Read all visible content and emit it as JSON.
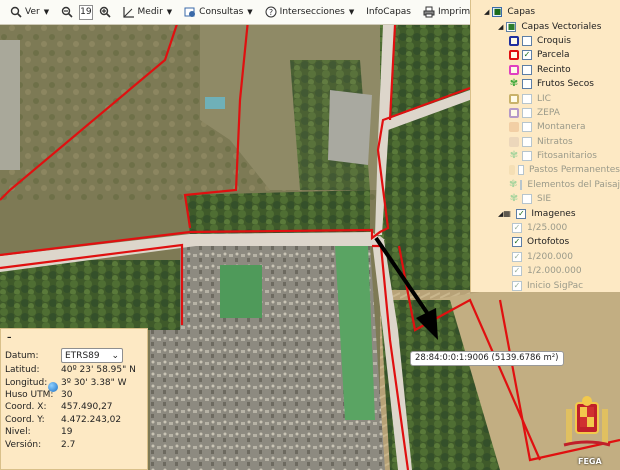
{
  "toolbar": {
    "ver_label": "Ver",
    "zoom_value": "19",
    "medir_label": "Medir",
    "consultas_label": "Consultas",
    "intersecciones_label": "Intersecciones",
    "infocapas_label": "InfoCapas",
    "imprimir_label": "Imprimir"
  },
  "layers": {
    "root_label": "Capas",
    "vector_label": "Capas Vectoriales",
    "items": [
      {
        "label": "Croquis",
        "color": "#1f2f9f",
        "checked": false,
        "enabled": true
      },
      {
        "label": "Parcela",
        "color": "#e01010",
        "checked": true,
        "enabled": true
      },
      {
        "label": "Recinto",
        "color": "#e040c0",
        "checked": false,
        "enabled": true
      },
      {
        "label": "Frutos Secos",
        "color": "#3fa93a",
        "checked": false,
        "enabled": true
      },
      {
        "label": "LIC",
        "color": "#c9b26a",
        "checked": false,
        "enabled": false
      },
      {
        "label": "ZEPA",
        "color": "#b59ac8",
        "checked": false,
        "enabled": false
      },
      {
        "label": "Montanera",
        "color": "#f2cfa5",
        "checked": false,
        "enabled": false
      },
      {
        "label": "Nitratos",
        "color": "#ecd7bb",
        "checked": false,
        "enabled": false
      },
      {
        "label": "Fitosanitarios",
        "color": "#a6d49d",
        "checked": false,
        "enabled": false
      },
      {
        "label": "Pastos Permanentes",
        "color": "#f5dfb5",
        "checked": false,
        "enabled": false
      },
      {
        "label": "Elementos del Paisaje",
        "color": "#a6d49d",
        "checked": false,
        "enabled": false
      },
      {
        "label": "SIE",
        "color": "#a6d49d",
        "checked": false,
        "enabled": false
      }
    ],
    "imagenes_label": "Imagenes",
    "image_items": [
      {
        "label": "1/25.000",
        "checked": true,
        "enabled": false
      },
      {
        "label": "Ortofotos",
        "checked": true,
        "enabled": true
      },
      {
        "label": "1/200.000",
        "checked": true,
        "enabled": false
      },
      {
        "label": "1/2.000.000",
        "checked": true,
        "enabled": false
      },
      {
        "label": "Inicio SigPac",
        "checked": true,
        "enabled": false
      }
    ]
  },
  "coords": {
    "minimize": "–",
    "datum_label": "Datum:",
    "datum_value": "ETRS89",
    "latitud_label": "Latitud:",
    "latitud_value": "40º 23' 58.95\" N",
    "longitud_label": "Longitud:",
    "longitud_value": "3º 30' 3.38\" W",
    "huso_label": "Huso UTM:",
    "huso_value": "30",
    "x_label": "Coord. X:",
    "x_value": "457.490,27",
    "y_label": "Coord. Y:",
    "y_value": "4.472.243,02",
    "nivel_label": "Nivel:",
    "nivel_value": "19",
    "version_label": "Versión:",
    "version_value": "2.7"
  },
  "popup": {
    "text": "28:84:0:0:1:9006 (5139.6786 m²)"
  },
  "fega": {
    "label": "FEGA"
  },
  "colors": {
    "parcel_border": "#e01010",
    "panel_bg": "#fde9c4"
  }
}
